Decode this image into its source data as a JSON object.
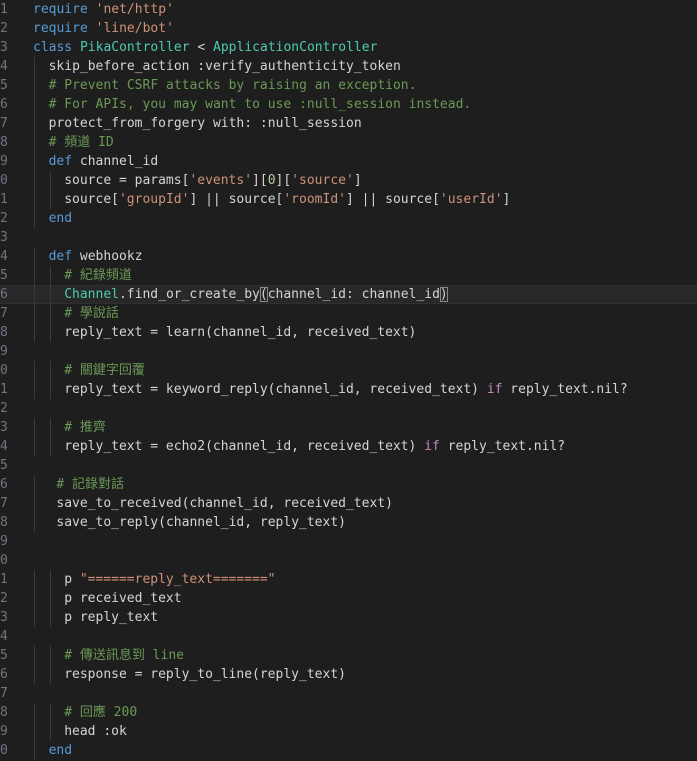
{
  "colors": {
    "background": "#1e1e1e",
    "active_line": "#282828",
    "line_number": "#6e7681",
    "keyword": "#569cd6",
    "keyword_control": "#c586c0",
    "string": "#ce9178",
    "comment": "#6a9955",
    "class": "#4ec9b0",
    "number": "#b5cea8",
    "text": "#d4d4d4"
  },
  "editor": {
    "language": "ruby",
    "active_line": 16,
    "lines": [
      {
        "n": "1",
        "indent": 0,
        "tokens": [
          [
            "kw",
            "require"
          ],
          [
            "pl",
            " "
          ],
          [
            "str",
            "'net/http'"
          ]
        ]
      },
      {
        "n": "2",
        "indent": 0,
        "tokens": [
          [
            "kw",
            "require"
          ],
          [
            "pl",
            " "
          ],
          [
            "str",
            "'line/bot'"
          ]
        ]
      },
      {
        "n": "3",
        "indent": 0,
        "tokens": [
          [
            "kw",
            "class"
          ],
          [
            "pl",
            " "
          ],
          [
            "cls",
            "PikaController"
          ],
          [
            "pl",
            " < "
          ],
          [
            "cls",
            "ApplicationController"
          ]
        ]
      },
      {
        "n": "4",
        "indent": 1,
        "tokens": [
          [
            "pl",
            "skip_before_action :verify_authenticity_token"
          ]
        ]
      },
      {
        "n": "5",
        "indent": 1,
        "tokens": [
          [
            "cm",
            "# Prevent CSRF attacks by raising an exception."
          ]
        ]
      },
      {
        "n": "6",
        "indent": 1,
        "tokens": [
          [
            "cm",
            "# For APIs, you may want to use :null_session instead."
          ]
        ]
      },
      {
        "n": "7",
        "indent": 1,
        "tokens": [
          [
            "pl",
            "protect_from_forgery with: :null_session"
          ]
        ]
      },
      {
        "n": "8",
        "indent": 1,
        "tokens": [
          [
            "cm",
            "# 頻道 ID"
          ]
        ]
      },
      {
        "n": "9",
        "indent": 1,
        "tokens": [
          [
            "kw",
            "def"
          ],
          [
            "pl",
            " channel_id"
          ]
        ]
      },
      {
        "n": "0",
        "indent": 2,
        "tokens": [
          [
            "pl",
            "source = params["
          ],
          [
            "str",
            "'events'"
          ],
          [
            "pl",
            "]["
          ],
          [
            "num",
            "0"
          ],
          [
            "pl",
            "]["
          ],
          [
            "str",
            "'source'"
          ],
          [
            "pl",
            "]"
          ]
        ]
      },
      {
        "n": "1",
        "indent": 2,
        "tokens": [
          [
            "pl",
            "source["
          ],
          [
            "str",
            "'groupId'"
          ],
          [
            "pl",
            "] || source["
          ],
          [
            "str",
            "'roomId'"
          ],
          [
            "pl",
            "] || source["
          ],
          [
            "str",
            "'userId'"
          ],
          [
            "pl",
            "]"
          ]
        ]
      },
      {
        "n": "2",
        "indent": 1,
        "tokens": [
          [
            "kw",
            "end"
          ]
        ]
      },
      {
        "n": "3",
        "indent": 0,
        "tokens": []
      },
      {
        "n": "4",
        "indent": 1,
        "tokens": [
          [
            "kw",
            "def"
          ],
          [
            "pl",
            " webhookz"
          ]
        ]
      },
      {
        "n": "5",
        "indent": 2,
        "tokens": [
          [
            "cm",
            "# 紀錄頻道"
          ]
        ]
      },
      {
        "n": "6",
        "indent": 2,
        "tokens": [
          [
            "cls",
            "Channel"
          ],
          [
            "pl",
            ".find_or_create_by"
          ],
          [
            "brk",
            "("
          ],
          [
            "pl",
            "channel_id: channel_id"
          ],
          [
            "brk",
            ")"
          ]
        ]
      },
      {
        "n": "7",
        "indent": 2,
        "tokens": [
          [
            "cm",
            "# 學說話"
          ]
        ]
      },
      {
        "n": "8",
        "indent": 2,
        "tokens": [
          [
            "pl",
            "reply_text = learn(channel_id, received_text)"
          ]
        ]
      },
      {
        "n": "9",
        "indent": 0,
        "tokens": []
      },
      {
        "n": "0",
        "indent": 2,
        "tokens": [
          [
            "cm",
            "# 關鍵字回覆"
          ]
        ]
      },
      {
        "n": "1",
        "indent": 2,
        "tokens": [
          [
            "pl",
            "reply_text = keyword_reply(channel_id, received_text) "
          ],
          [
            "kw2",
            "if"
          ],
          [
            "pl",
            " reply_text.nil?"
          ]
        ]
      },
      {
        "n": "2",
        "indent": 0,
        "tokens": []
      },
      {
        "n": "3",
        "indent": 2,
        "tokens": [
          [
            "cm",
            "# 推齊"
          ]
        ]
      },
      {
        "n": "4",
        "indent": 2,
        "tokens": [
          [
            "pl",
            "reply_text = echo2(channel_id, received_text) "
          ],
          [
            "kw2",
            "if"
          ],
          [
            "pl",
            " reply_text.nil?"
          ]
        ]
      },
      {
        "n": "5",
        "indent": 0,
        "tokens": []
      },
      {
        "n": "6",
        "indent": 1.5,
        "tokens": [
          [
            "cm",
            "# 記錄對話"
          ]
        ]
      },
      {
        "n": "7",
        "indent": 1.5,
        "tokens": [
          [
            "pl",
            "save_to_received(channel_id, received_text)"
          ]
        ]
      },
      {
        "n": "8",
        "indent": 1.5,
        "tokens": [
          [
            "pl",
            "save_to_reply(channel_id, reply_text)"
          ]
        ]
      },
      {
        "n": "9",
        "indent": 0,
        "tokens": []
      },
      {
        "n": "0",
        "indent": 0,
        "tokens": []
      },
      {
        "n": "1",
        "indent": 2,
        "tokens": [
          [
            "pl",
            "p "
          ],
          [
            "str",
            "\"======reply_text=======\""
          ]
        ]
      },
      {
        "n": "2",
        "indent": 2,
        "tokens": [
          [
            "pl",
            "p received_text"
          ]
        ]
      },
      {
        "n": "3",
        "indent": 2,
        "tokens": [
          [
            "pl",
            "p reply_text"
          ]
        ]
      },
      {
        "n": "4",
        "indent": 0,
        "tokens": []
      },
      {
        "n": "5",
        "indent": 2,
        "tokens": [
          [
            "cm",
            "# 傳送訊息到 line"
          ]
        ]
      },
      {
        "n": "6",
        "indent": 2,
        "tokens": [
          [
            "pl",
            "response = reply_to_line(reply_text)"
          ]
        ]
      },
      {
        "n": "7",
        "indent": 0,
        "tokens": []
      },
      {
        "n": "8",
        "indent": 2,
        "tokens": [
          [
            "cm",
            "# 回應 200"
          ]
        ]
      },
      {
        "n": "9",
        "indent": 2,
        "tokens": [
          [
            "pl",
            "head :ok"
          ]
        ]
      },
      {
        "n": "0",
        "indent": 1,
        "tokens": [
          [
            "kw",
            "end"
          ]
        ]
      }
    ]
  }
}
